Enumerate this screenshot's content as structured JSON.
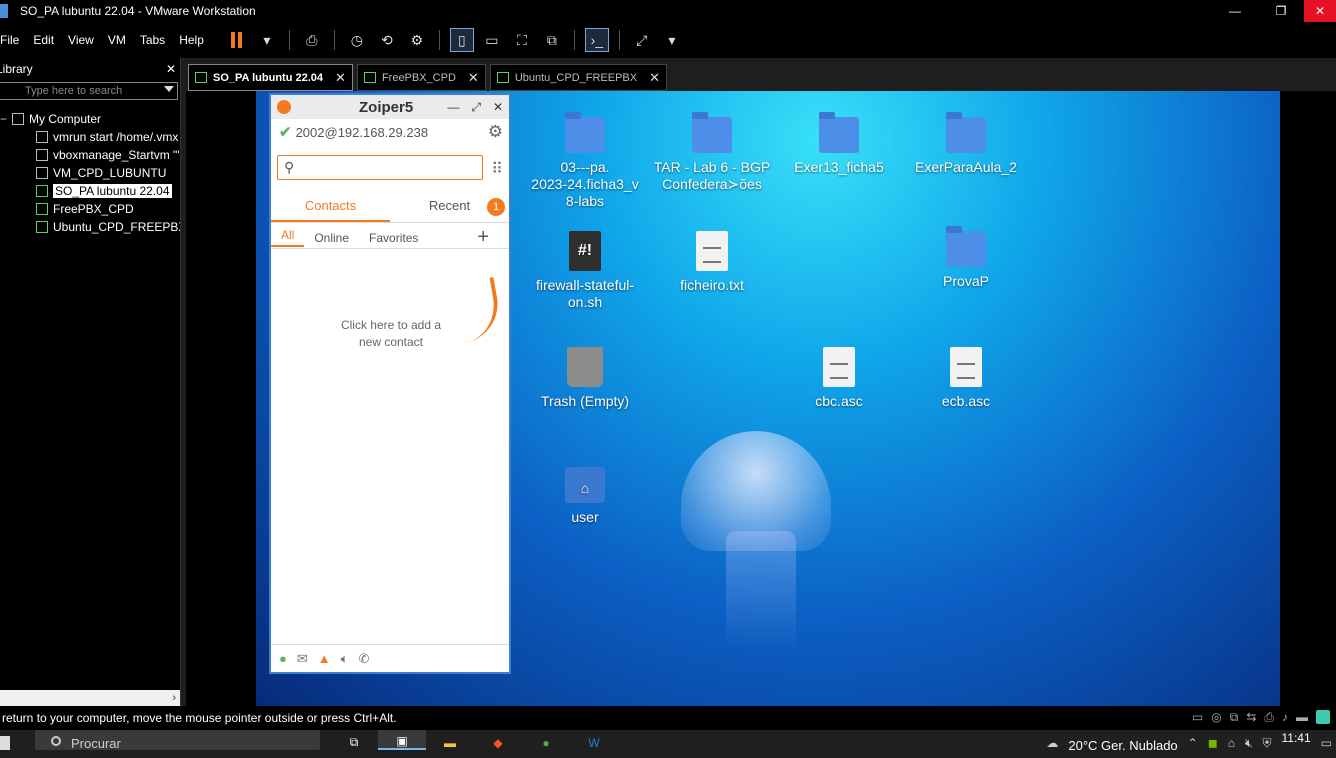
{
  "window": {
    "title": "SO_PA lubuntu 22.04 - VMware Workstation",
    "minimize": "—",
    "maximize": "❐",
    "close": "✕"
  },
  "menu": [
    "File",
    "Edit",
    "View",
    "VM",
    "Tabs",
    "Help"
  ],
  "library": {
    "title": "Library",
    "close": "✕",
    "search_placeholder": "Type here to search",
    "root": "My Computer",
    "items": [
      {
        "label": "vmrun start /home/.vmx",
        "type": "file"
      },
      {
        "label": "vboxmanage_Startvm \"\"",
        "type": "file"
      },
      {
        "label": "VM_CPD_LUBUNTU",
        "type": "file"
      },
      {
        "label": "SO_PA lubuntu 22.04",
        "type": "vm",
        "selected": true
      },
      {
        "label": "FreePBX_CPD",
        "type": "vm"
      },
      {
        "label": "Ubuntu_CPD_FREEPBX",
        "type": "vm"
      }
    ],
    "scroll_right": "›"
  },
  "tabs": [
    {
      "label": "SO_PA lubuntu 22.04",
      "active": true
    },
    {
      "label": "FreePBX_CPD",
      "active": false
    },
    {
      "label": "Ubuntu_CPD_FREEPBX",
      "active": false
    }
  ],
  "desktop_icons": [
    {
      "label": "03---pa.\n2023-24.ficha3_v\n8-labs",
      "kind": "folder"
    },
    {
      "label": "TAR - Lab 6 - BGP\nConfedera≻ões",
      "kind": "folder"
    },
    {
      "label": "Exer13_ficha5",
      "kind": "folder"
    },
    {
      "label": "ExerParaAula_2",
      "kind": "folder"
    },
    {
      "label": "firewall-stateful-\non.sh",
      "kind": "script",
      "glyph": "#!"
    },
    {
      "label": "ficheiro.txt",
      "kind": "doc"
    },
    {
      "label": "ProvaP",
      "kind": "folder"
    },
    {
      "label": "Trash (Empty)",
      "kind": "trash"
    },
    {
      "label": "cbc.asc",
      "kind": "doc"
    },
    {
      "label": "ecb.asc",
      "kind": "doc"
    },
    {
      "label": "user",
      "kind": "home",
      "glyph": "⌂"
    }
  ],
  "zoiper": {
    "title": "Zoiper5",
    "account": "2002@192.168.29.238",
    "tab_contacts": "Contacts",
    "tab_recent": "Recent",
    "recent_badge": "1",
    "filters": [
      "All",
      "Online",
      "Favorites"
    ],
    "hint": "Click here to add a new contact"
  },
  "statusbar": {
    "text": "To return to your computer, move the mouse pointer outside or press Ctrl+Alt."
  },
  "taskbar": {
    "search_placeholder": "Procurar",
    "weather": "20°C  Ger. Nublado",
    "time": "11:41"
  }
}
